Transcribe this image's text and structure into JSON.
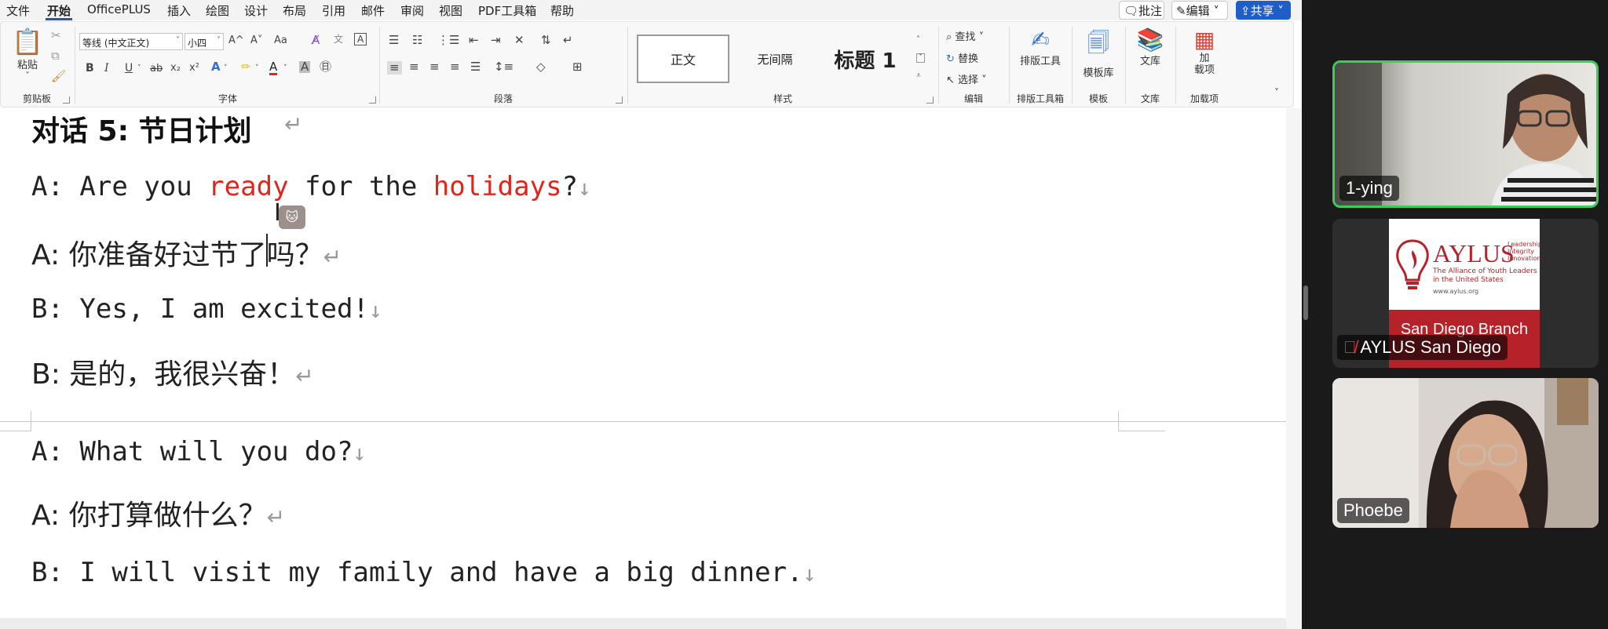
{
  "menu": {
    "items": [
      "文件",
      "开始",
      "OfficePLUS",
      "插入",
      "绘图",
      "设计",
      "布局",
      "引用",
      "邮件",
      "审阅",
      "视图",
      "PDF工具箱",
      "帮助"
    ],
    "active": "开始",
    "comments_btn": "批注",
    "edit_btn": "编辑",
    "share_btn": "共享"
  },
  "ribbon": {
    "clipboard": {
      "paste": "粘贴",
      "label": "剪贴板"
    },
    "font": {
      "name": "等线 (中文正文)",
      "size": "小四",
      "grow": "A^",
      "shrink": "A˅",
      "case": "Aa",
      "bold": "B",
      "italic": "I",
      "underline": "U",
      "strike": "ab",
      "sub": "x₂",
      "sup": "x²",
      "label": "字体"
    },
    "paragraph": {
      "label": "段落"
    },
    "styles": {
      "normal": "正文",
      "no_spacing": "无间隔",
      "heading1": "标题 1",
      "label": "样式"
    },
    "editing": {
      "find": "查找",
      "replace": "替换",
      "select": "选择",
      "label": "编辑"
    },
    "typeset": {
      "btn": "排版工具",
      "label": "排版工具箱"
    },
    "templates": {
      "btn": "模板库",
      "label": "模板"
    },
    "library": {
      "btn": "文库",
      "label": "文库"
    },
    "addins": {
      "btn": "加\n载项",
      "label": "加载项"
    }
  },
  "document": {
    "heading": "对话 5: 节日计划",
    "lines": [
      {
        "speaker": "A: ",
        "parts": [
          "Are you ",
          "ready",
          " for the ",
          "holidays",
          "?"
        ],
        "mark": "↓"
      },
      {
        "speaker": "A: ",
        "text": "你准备好过节了吗？",
        "mark": "↵"
      },
      {
        "speaker": "B: ",
        "text": "Yes, I am excited!",
        "mark": "↓"
      },
      {
        "speaker": "B: ",
        "text": "是的，我很兴奋！",
        "mark": "↵"
      },
      {
        "speaker": "A: ",
        "text": "What will you do?",
        "mark": "↓"
      },
      {
        "speaker": "A: ",
        "text": "你打算做什么？",
        "mark": "↵"
      },
      {
        "speaker": "B: ",
        "text": "I will visit my family and have a big dinner.",
        "mark": "↓"
      }
    ],
    "highlight_color": "#e0251b"
  },
  "zoom": {
    "participants": [
      {
        "name": "1-ying",
        "speaking": true
      },
      {
        "name": "AYLUS San Diego",
        "muted": true
      },
      {
        "name": "Phoebe"
      }
    ],
    "aylus_logo": {
      "title": "AYLUS",
      "tagline": "Leadership\nIntegrity\nInnovation",
      "subtitle": "The Alliance of Youth Leaders\nin the United States",
      "url": "www.aylus.org",
      "branch": "San Diego Branch"
    }
  }
}
